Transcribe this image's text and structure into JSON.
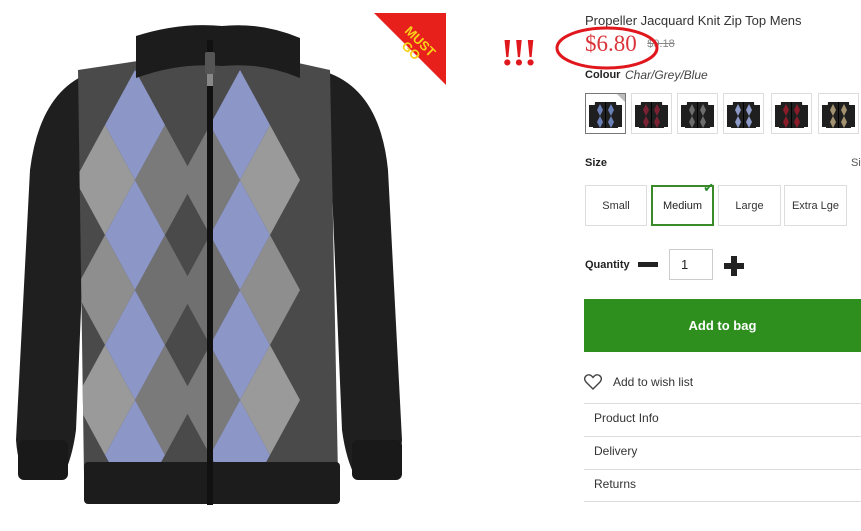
{
  "product": {
    "title": "Propeller Jacquard Knit Zip Top Mens",
    "price": "$6.80",
    "was_price": "$9.18",
    "badge": "MUST GO",
    "exclamation": "!!!"
  },
  "colour": {
    "label": "Colour",
    "value": "Char/Grey/Blue",
    "swatches": [
      {
        "accent": "#6a7fb6",
        "selected": true
      },
      {
        "accent": "#7a2233",
        "selected": false
      },
      {
        "accent": "#6d6d6d",
        "selected": false
      },
      {
        "accent": "#8d9ac7",
        "selected": false
      },
      {
        "accent": "#8a1c2a",
        "selected": false
      },
      {
        "accent": "#a39370",
        "selected": false
      }
    ]
  },
  "size": {
    "label": "Size",
    "guide": "Si",
    "options": [
      "Small",
      "Medium",
      "Large",
      "Extra Lge"
    ],
    "selected": "Medium"
  },
  "quantity": {
    "label": "Quantity",
    "value": "1"
  },
  "actions": {
    "add_to_bag": "Add to bag",
    "wishlist": "Add to wish list"
  },
  "info_links": [
    "Product Info",
    "Delivery",
    "Returns"
  ],
  "colors": {
    "primary_green": "#2e8f1f",
    "price_red": "#d9343a",
    "annotation_red": "#e0171c",
    "badge_red": "#e8201c",
    "badge_text": "#f7d117"
  }
}
